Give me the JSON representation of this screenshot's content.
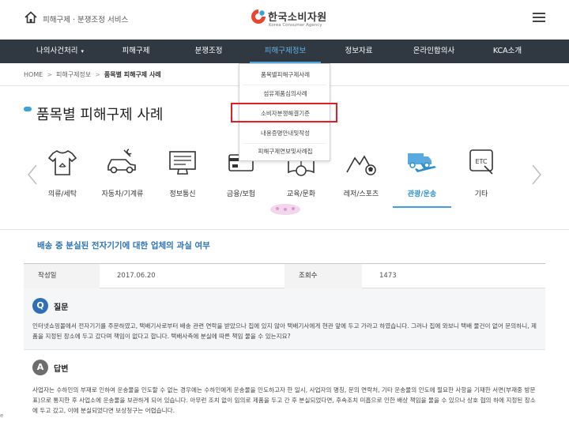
{
  "header": {
    "service_label": "피해구제 · 분쟁조정 서비스",
    "logo_ko": "한국소비자원",
    "logo_en": "Korea Consumer Agency",
    "icons": {
      "home": "home-icon",
      "menu": "hamburger-icon"
    }
  },
  "nav": {
    "items": [
      {
        "label": "나의사건처리",
        "caret": "▾"
      },
      {
        "label": "피해구제"
      },
      {
        "label": "분쟁조정"
      },
      {
        "label": "피해구제정보"
      },
      {
        "label": "정보자료"
      },
      {
        "label": "온라인합의사"
      },
      {
        "label": "KCA소개"
      }
    ],
    "active_index": 3
  },
  "breadcrumb": {
    "home": "HOME",
    "level1": "피해구제정보",
    "current": "품목별 피해구제 사례",
    "separator": ">"
  },
  "page_title": "품목별 피해구제 사례",
  "dropdown": {
    "items": [
      {
        "label": "품목별피해구제사례"
      },
      {
        "label": "섬유제품심의사례"
      },
      {
        "label": "소비자분쟁해결기준"
      },
      {
        "label": "내용증명안내및작성"
      },
      {
        "label": "피해구제연보및사례집"
      }
    ],
    "highlighted_index": 2,
    "highlight_color": "#e21d25"
  },
  "categories": {
    "items": [
      {
        "label": "의류/세탁",
        "icon": "shirt-icon"
      },
      {
        "label": "자동차/기계류",
        "icon": "car-wrench-icon"
      },
      {
        "label": "정보통신",
        "icon": "monitor-icon"
      },
      {
        "label": "금융/보험",
        "icon": "card-icon"
      },
      {
        "label": "교육/문화",
        "icon": "book-icon"
      },
      {
        "label": "레저/스포츠",
        "icon": "mountain-ball-icon"
      },
      {
        "label": "관광/운송",
        "icon": "truck-plane-icon"
      },
      {
        "label": "기타",
        "icon": "etc-sign-icon"
      }
    ],
    "active_index": 6,
    "prev_icon": "chevron-left-icon",
    "next_icon": "chevron-right-icon"
  },
  "article": {
    "title": "배송 중 분실된 전자기기에 대한 업체의 과실 여부",
    "date_label": "작성일",
    "date_value": "2017.06.20",
    "views_label": "조회수",
    "views_value": "1473",
    "question": {
      "badge": "Q",
      "label": "질문",
      "text": "인터넷쇼핑몰에서 전자기기를 주문하였고, 택배기사로부터 배송 관련 연락을 받았으나 집에 있지 않아 택배기사에게 현관 앞에 두고 가라고 하였습니다. 그러나 집에 와보니 택배 물건이 없어 문의하니, 제품을 지정된 장소에 두고 갔다며 책임이 없다고 합니다. 택배사측에 분실에 따른 책임 물을 수 있는지요?"
    },
    "answer": {
      "badge": "A",
      "label": "답변",
      "text": "사업자는 수하인의 부재로 인하여 운송물을 인도할 수 없는 경우에는 수하인에게 운송물을 인도하고자 한 일시, 사업자의 명칭, 문의 연락처, 기타 운송물의 인도에 필요한 사항을 기재한 서면(부재중 방문표)으로 통지한 후 사업소에 운송물을 보관하게 되어 있습니다. 아무런 조치 없이 임의로 제품을 두고 간 후 분실되었다면, 후속조치 미흡으로 인한 배상 책임을 물을 수 있으나 상호 협의 하에 지정된 장소에 두고 갔고, 이에 분실되었다면 보상청구는 어렵습니다."
    }
  },
  "edge_tag": "e",
  "colors": {
    "nav_bg": "#303841",
    "accent": "#3fa0dc",
    "title_blue": "#2a73b8"
  }
}
